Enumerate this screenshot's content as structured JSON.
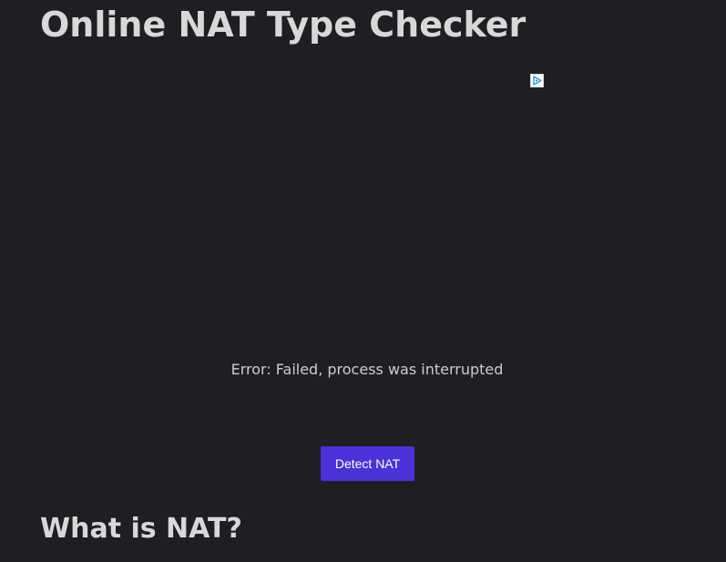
{
  "page": {
    "title": "Online NAT Type Checker",
    "section_heading": "What is NAT?"
  },
  "ad": {
    "icon": "adchoices-icon",
    "icon_color": "#1ba1d7"
  },
  "status": {
    "message": "Error: Failed, process was interrupted"
  },
  "actions": {
    "detect_label": "Detect NAT",
    "detect_color": "#4a32d8"
  },
  "colors": {
    "background": "#1e1f22",
    "text": "#d8d8d8"
  }
}
